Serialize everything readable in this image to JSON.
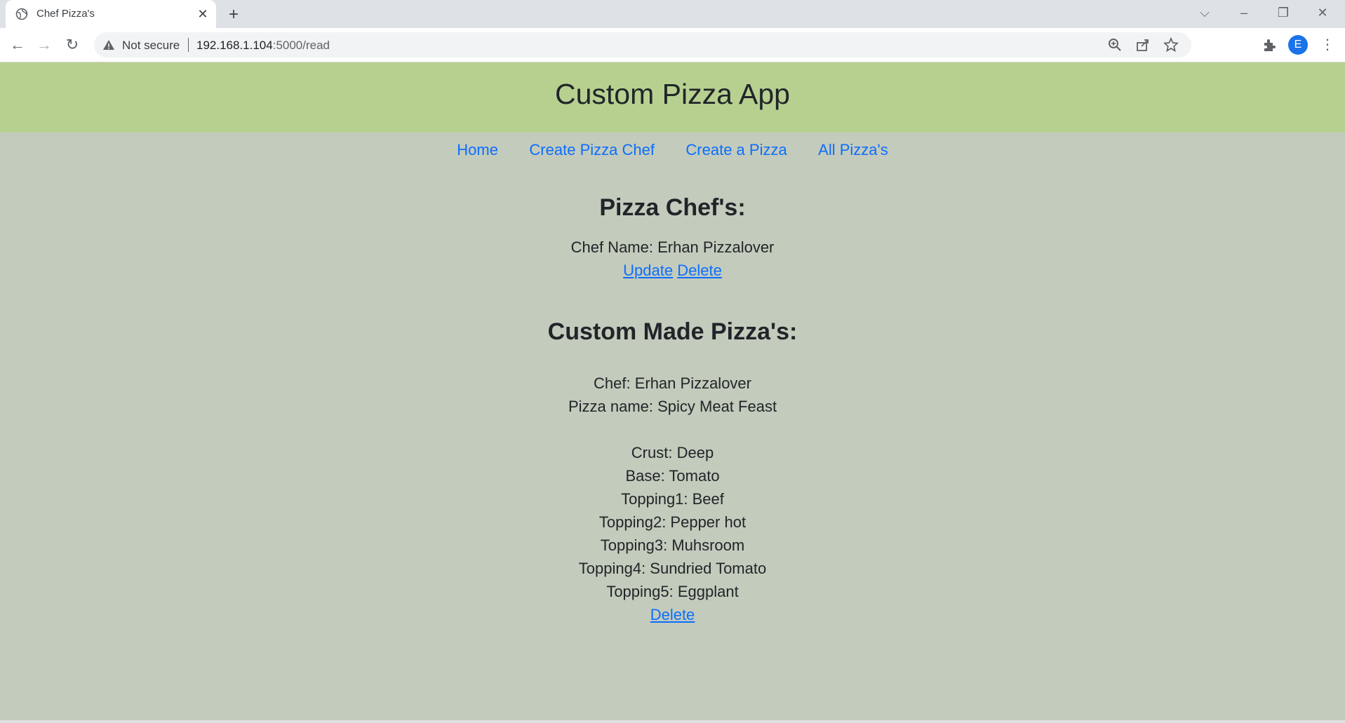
{
  "browser": {
    "tab_title": "Chef Pizza's",
    "security_label": "Not secure",
    "url_host": "192.168.1.104",
    "url_rest": ":5000/read",
    "profile_initial": "E"
  },
  "app": {
    "title": "Custom Pizza App"
  },
  "nav": {
    "items": [
      {
        "label": "Home"
      },
      {
        "label": "Create Pizza Chef"
      },
      {
        "label": "Create a Pizza"
      },
      {
        "label": "All Pizza's"
      }
    ]
  },
  "chefs_section": {
    "heading": "Pizza Chef's:",
    "chef_name": "Chef Name: Erhan Pizzalover",
    "update_label": "Update",
    "delete_label": "Delete"
  },
  "pizzas_section": {
    "heading": "Custom Made Pizza's:",
    "chef": "Chef: Erhan Pizzalover",
    "pizza_name": "Pizza name: Spicy Meat Feast",
    "crust": "Crust: Deep",
    "base": "Base: Tomato",
    "topping1": "Topping1: Beef",
    "topping2": "Topping2: Pepper hot",
    "topping3": "Topping3: Muhsroom",
    "topping4": "Topping4: Sundried Tomato",
    "topping5": "Topping5: Eggplant",
    "delete_label": "Delete"
  },
  "colors": {
    "header_bg": "#b7d090",
    "page_bg": "#c3cbbc",
    "link": "#0d6efd"
  }
}
